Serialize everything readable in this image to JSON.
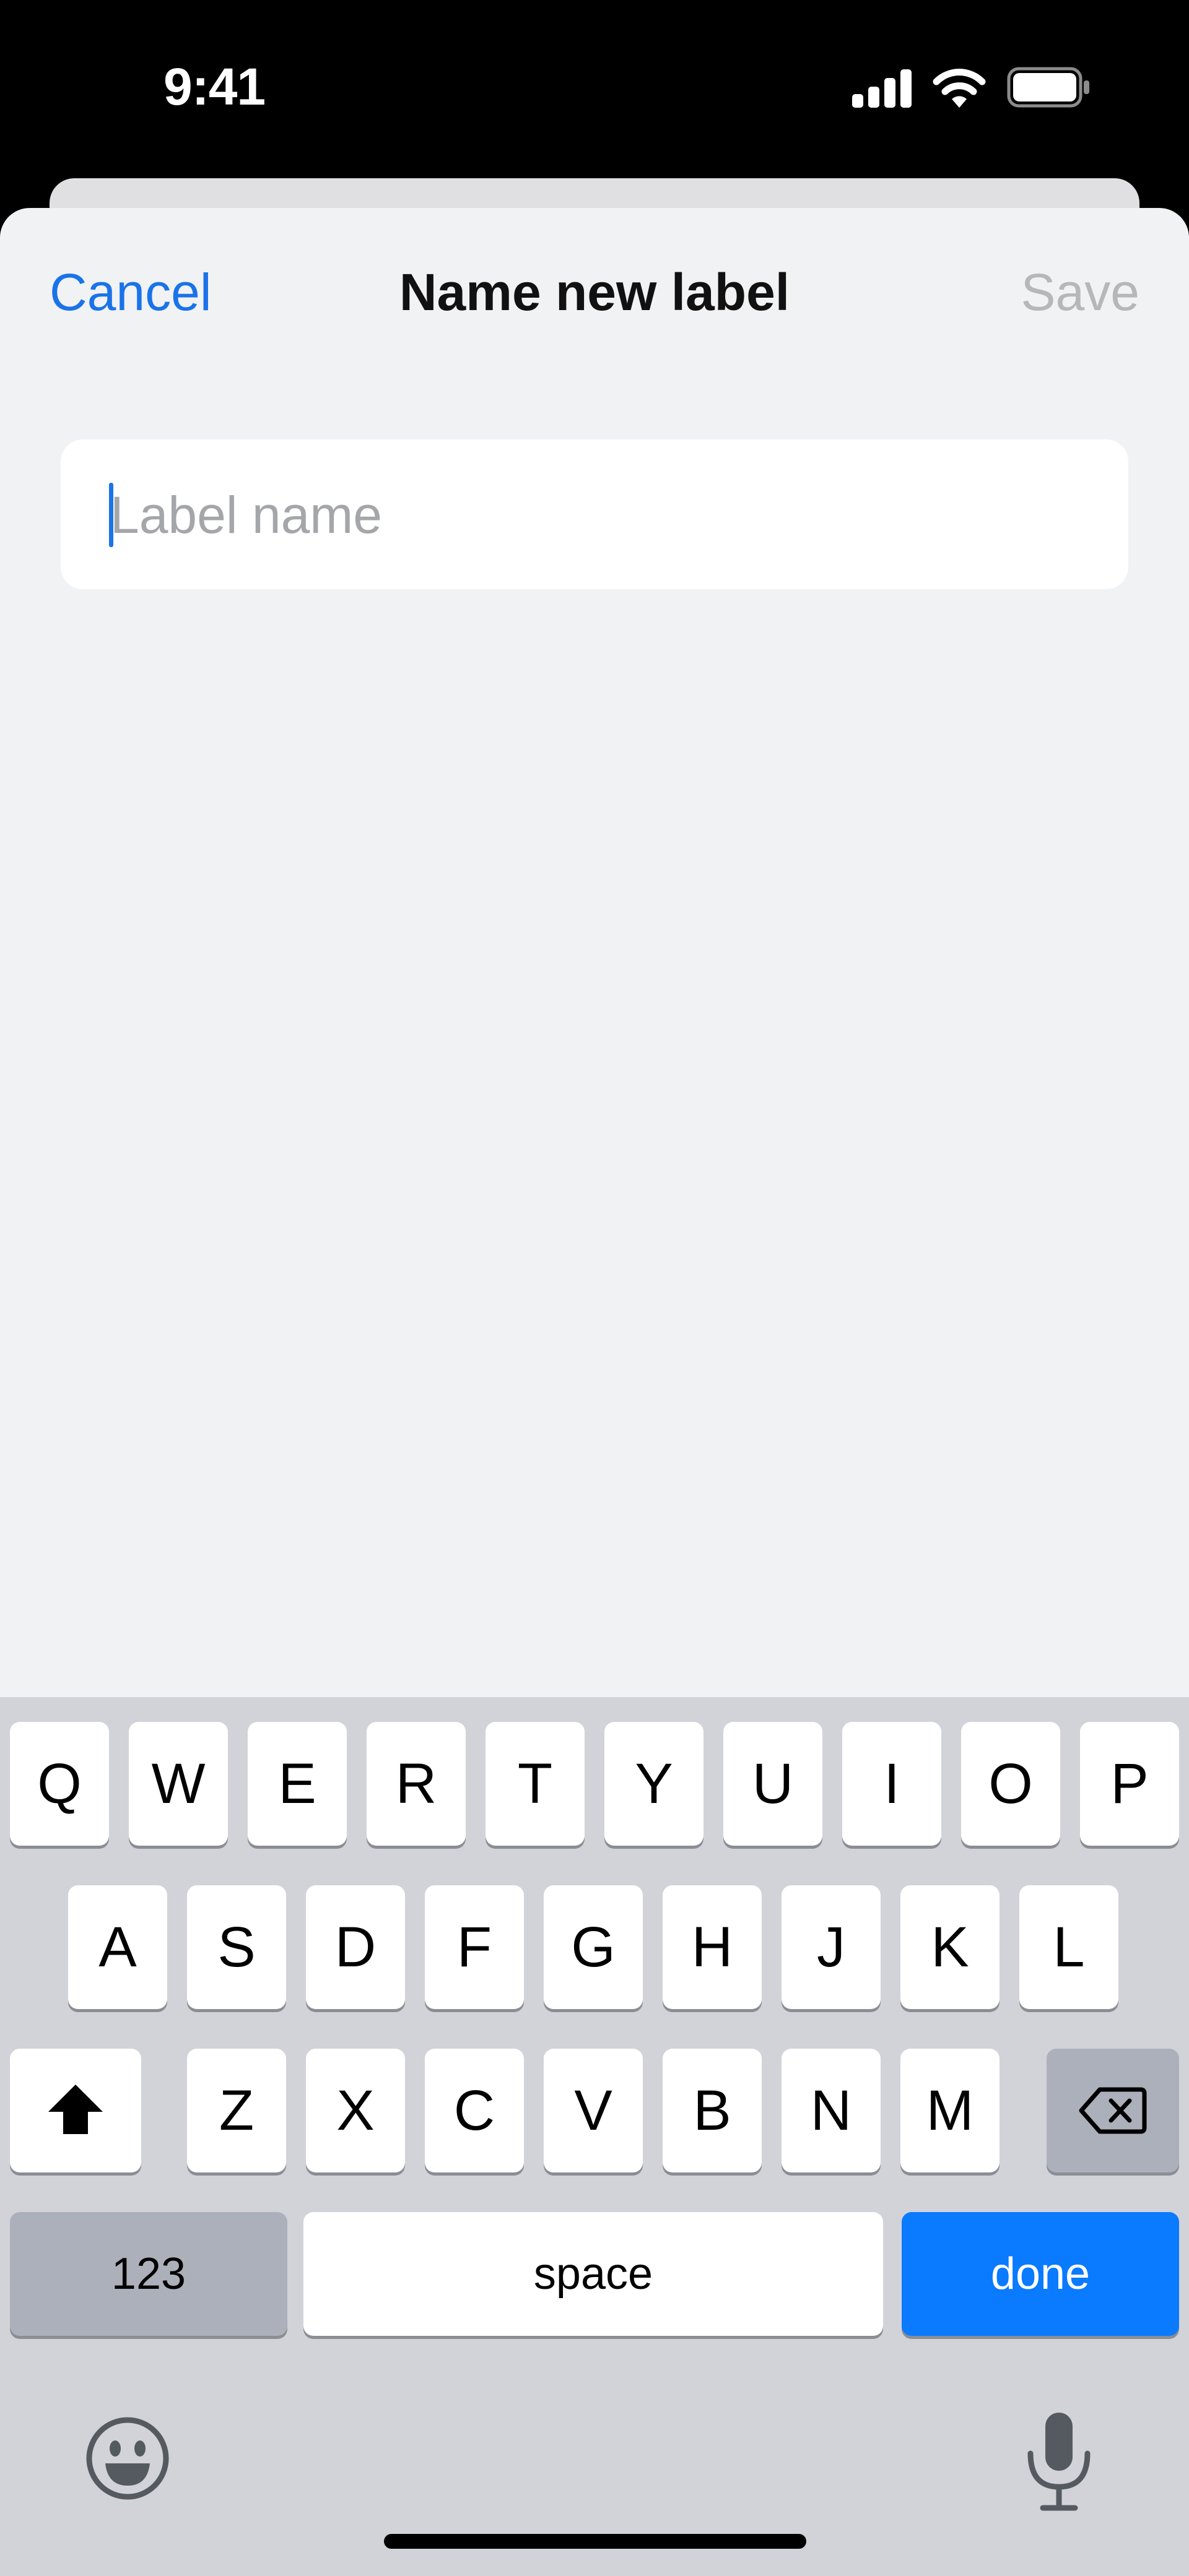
{
  "status_bar": {
    "time": "9:41"
  },
  "nav": {
    "cancel_label": "Cancel",
    "title": "Name new label",
    "save_label": "Save"
  },
  "field": {
    "placeholder": "Label name",
    "value": ""
  },
  "keyboard": {
    "row1": [
      "Q",
      "W",
      "E",
      "R",
      "T",
      "Y",
      "U",
      "I",
      "O",
      "P"
    ],
    "row2": [
      "A",
      "S",
      "D",
      "F",
      "G",
      "H",
      "J",
      "K",
      "L"
    ],
    "row3": [
      "Z",
      "X",
      "C",
      "V",
      "B",
      "N",
      "M"
    ],
    "numbers_label": "123",
    "space_label": "space",
    "done_label": "done"
  },
  "icons": [
    "cellular-signal-icon",
    "wifi-icon",
    "battery-icon",
    "shift-icon",
    "backspace-icon",
    "emoji-icon",
    "microphone-icon"
  ],
  "colors": {
    "accent": "#1a73e8",
    "done_key": "#0a7aff",
    "sheet_bg": "#f1f2f4",
    "keyboard_bg": "#d1d3d9"
  }
}
